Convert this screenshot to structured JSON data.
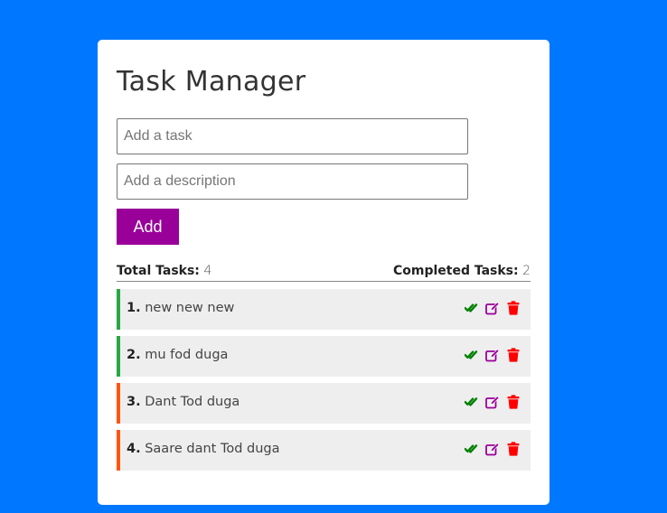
{
  "app": {
    "title": "Task Manager"
  },
  "form": {
    "task_placeholder": "Add a task",
    "task_value": "",
    "description_placeholder": "Add a description",
    "description_value": "",
    "add_label": "Add"
  },
  "stats": {
    "total_label": "Total Tasks:",
    "total_value": "4",
    "completed_label": "Completed Tasks:",
    "completed_value": "2"
  },
  "tasks": [
    {
      "index": "1.",
      "name": "new new new",
      "completed": true
    },
    {
      "index": "2.",
      "name": "mu fod duga",
      "completed": true
    },
    {
      "index": "3.",
      "name": "Dant Tod duga",
      "completed": false
    },
    {
      "index": "4.",
      "name": "Saare dant Tod duga",
      "completed": false
    }
  ],
  "colors": {
    "background": "#0077ff",
    "add_button": "#990099",
    "completed_border": "#28a745",
    "pending_border": "#ff5511",
    "check_icon": "#008000",
    "edit_icon": "#990099",
    "delete_icon": "#ff0000"
  },
  "icons": {
    "complete": "double-check-icon",
    "edit": "edit-icon",
    "delete": "trash-icon"
  }
}
